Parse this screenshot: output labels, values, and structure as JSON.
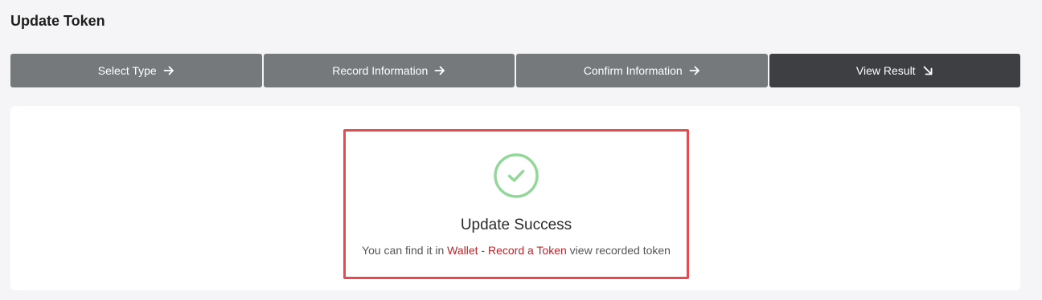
{
  "page": {
    "title": "Update Token"
  },
  "steps": [
    {
      "label": "Select Type",
      "icon": "arrow-right-icon"
    },
    {
      "label": "Record Information",
      "icon": "arrow-right-icon"
    },
    {
      "label": "Confirm Information",
      "icon": "arrow-right-icon"
    },
    {
      "label": "View Result",
      "icon": "arrow-down-right-icon",
      "active": true
    }
  ],
  "result": {
    "icon": "check-circle-icon",
    "title": "Update Success",
    "desc_prefix": "You can find it in",
    "link_text": "Wallet - Record a Token",
    "desc_suffix": "view recorded token"
  },
  "colors": {
    "step_bg": "#76797c",
    "step_active_bg": "#3e3f43",
    "success_green": "#93d89a",
    "highlight_border": "#e6494e",
    "link": "#b8282d"
  }
}
